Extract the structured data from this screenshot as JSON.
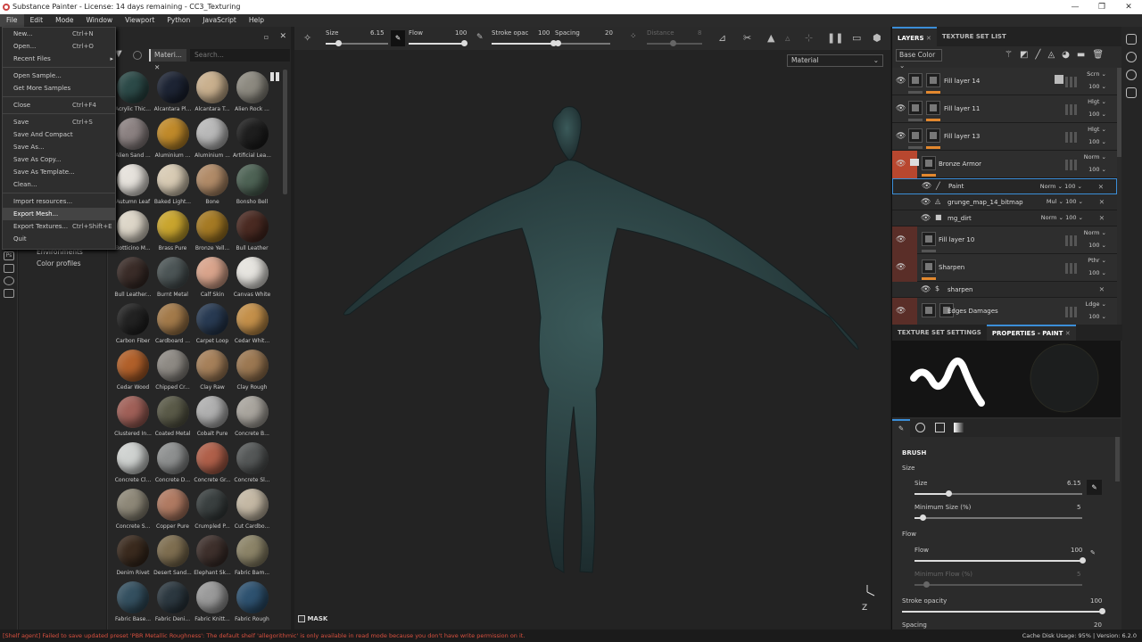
{
  "window": {
    "title": "Substance Painter - License: 14 days remaining - CC3_Texturing",
    "controls": [
      "—",
      "❐",
      "✕"
    ]
  },
  "menubar": [
    "File",
    "Edit",
    "Mode",
    "Window",
    "Viewport",
    "Python",
    "JavaScript",
    "Help"
  ],
  "file_menu": [
    {
      "label": "New...",
      "shortcut": "Ctrl+N"
    },
    {
      "label": "Open...",
      "shortcut": "Ctrl+O"
    },
    {
      "label": "Recent Files",
      "submenu": true
    },
    {
      "sep": true
    },
    {
      "label": "Open Sample..."
    },
    {
      "label": "Get More Samples"
    },
    {
      "sep": true
    },
    {
      "label": "Close",
      "shortcut": "Ctrl+F4"
    },
    {
      "sep": true
    },
    {
      "label": "Save",
      "shortcut": "Ctrl+S"
    },
    {
      "label": "Save And Compact"
    },
    {
      "label": "Save As..."
    },
    {
      "label": "Save As Copy..."
    },
    {
      "label": "Save As Template..."
    },
    {
      "label": "Clean..."
    },
    {
      "sep": true
    },
    {
      "label": "Import resources..."
    },
    {
      "label": "Export Mesh...",
      "highlighted": true
    },
    {
      "label": "Export Textures...",
      "shortcut": "Ctrl+Shift+E"
    },
    {
      "label": "Quit"
    }
  ],
  "shelf": {
    "categories": [
      "Environments",
      "Color profiles"
    ],
    "filter_tag": "Materi...",
    "search_placeholder": "Search...",
    "materials": [
      [
        "Acrylic Thic...",
        "#2c4a48"
      ],
      [
        "Alcantara Pl...",
        "#1d2434"
      ],
      [
        "Alcantara T...",
        "#c9b08e"
      ],
      [
        "Alien Rock ...",
        "#8d8a80"
      ],
      [
        "Alien Sand ...",
        "#8c8282"
      ],
      [
        "Aluminium ...",
        "#c08a2a"
      ],
      [
        "Aluminium ...",
        "#b9b9b9"
      ],
      [
        "Artificial Lea...",
        "#1e1e1e"
      ],
      [
        "Autumn Leaf",
        "#e6e2dc"
      ],
      [
        "Baked Light...",
        "#d8cbb4"
      ],
      [
        "Bone",
        "#b18b68"
      ],
      [
        "Bonsho Bell",
        "#4e6355"
      ],
      [
        "Botticino M...",
        "#ddd6c8"
      ],
      [
        "Brass Pure",
        "#c9a52e"
      ],
      [
        "Bronze Yell...",
        "#a57a24"
      ],
      [
        "Bull Leather",
        "#4a2a22"
      ],
      [
        "Bull Leather...",
        "#3a2c28"
      ],
      [
        "Burnt Metal",
        "#4c5556"
      ],
      [
        "Calf Skin",
        "#d9a48c"
      ],
      [
        "Canvas White",
        "#e6e4df"
      ],
      [
        "Carbon Fiber",
        "#222222"
      ],
      [
        "Cardboard ...",
        "#a37a4a"
      ],
      [
        "Carpet Loop",
        "#283a52"
      ],
      [
        "Cedar Whit...",
        "#c4904a"
      ],
      [
        "Cedar Wood",
        "#b1602a"
      ],
      [
        "Chipped Cr...",
        "#8e8a84"
      ],
      [
        "Clay Raw",
        "#a6805a"
      ],
      [
        "Clay Rough",
        "#9c7852"
      ],
      [
        "Clustered In...",
        "#a06058"
      ],
      [
        "Coated Metal",
        "#5a5a48"
      ],
      [
        "Cobalt Pure",
        "#b0b0b0"
      ],
      [
        "Concrete B...",
        "#a9a59e"
      ],
      [
        "Concrete Cl...",
        "#cfd2d0"
      ],
      [
        "Concrete D...",
        "#8e9090"
      ],
      [
        "Concrete Gr...",
        "#b0604a"
      ],
      [
        "Concrete Sl...",
        "#555858"
      ],
      [
        "Concrete S...",
        "#8e8878"
      ],
      [
        "Copper Pure",
        "#b07a62"
      ],
      [
        "Crumpled P...",
        "#3a4040"
      ],
      [
        "Cut Cardbo...",
        "#c4b8a4"
      ],
      [
        "Denim Rivet",
        "#3a2a1e"
      ],
      [
        "Desert Sand...",
        "#7e6e50"
      ],
      [
        "Elephant Sk...",
        "#3e302c"
      ],
      [
        "Fabric Bam...",
        "#8c8468"
      ],
      [
        "Fabric Base...",
        "#345060"
      ],
      [
        "Fabric Deni...",
        "#2c3840"
      ],
      [
        "Fabric Knitt...",
        "#9a9a9a"
      ],
      [
        "Fabric Rough",
        "#2e5270"
      ]
    ]
  },
  "toolbar": {
    "size_label": "Size",
    "size_value": "6.15",
    "size_fraction": 0.2,
    "flow_label": "Flow",
    "flow_value": "100",
    "flow_fraction": 1.0,
    "stroke_label": "Stroke opac",
    "stroke_value": "100",
    "spacing_label": "Spacing",
    "spacing_value": "20",
    "spacing_fraction": 0.05,
    "distance_label": "Distance",
    "distance_value": "8"
  },
  "viewport": {
    "material_mode": "Material",
    "mask_label": "MASK",
    "axis_label": "Z"
  },
  "layers": {
    "tabs": [
      "LAYERS",
      "TEXTURE SET LIST"
    ],
    "channel": "Base Color",
    "rows": [
      {
        "name": "Fill layer 14",
        "blend": "Scrn",
        "opacity": "100"
      },
      {
        "name": "Fill layer 11",
        "blend": "Hlgt",
        "opacity": "100"
      },
      {
        "name": "Fill layer 13",
        "blend": "Hlgt",
        "opacity": "100"
      },
      {
        "name": "Bronze Armor",
        "blend": "Norm",
        "opacity": "100"
      },
      {
        "name": "Paint",
        "blend": "Norm",
        "opacity": "100"
      },
      {
        "name": "grunge_map_14_bitmap",
        "blend": "Mul",
        "opacity": "100"
      },
      {
        "name": "mg_dirt",
        "blend": "Norm",
        "opacity": "100"
      },
      {
        "name": "Fill layer 10",
        "blend": "Norm",
        "opacity": "100"
      },
      {
        "name": "Sharpen",
        "blend": "Pthr",
        "opacity": "100"
      },
      {
        "name": "sharpen"
      },
      {
        "name": "Edges Damages",
        "blend": "Ldge",
        "opacity": "100"
      }
    ]
  },
  "properties": {
    "tabs": [
      "TEXTURE SET SETTINGS",
      "PROPERTIES - PAINT"
    ],
    "section": "BRUSH",
    "size_group": "Size",
    "size_label": "Size",
    "size_value": "6.15",
    "size_fraction": 0.2,
    "minsize_label": "Minimum Size (%)",
    "minsize_value": "5",
    "minsize_fraction": 0.05,
    "flow_group": "Flow",
    "flow_label": "Flow",
    "flow_value": "100",
    "flow_fraction": 1.0,
    "minflow_label": "Minimum Flow (%)",
    "minflow_value": "5",
    "stroke_label": "Stroke opacity",
    "stroke_value": "100",
    "spacing_label": "Spacing",
    "spacing_value": "20"
  },
  "status": {
    "error": "[Shelf agent] Failed to save updated preset 'PBR Metallic Roughness': The default shelf 'allegorithmic' is only available in read mode because you don't have write permission on it.",
    "cache": "Cache Disk Usage:   95% | Version: 6.2.0"
  },
  "colors": {
    "accent": "#3b8ed8",
    "orange": "#e3882e",
    "group_red": "#b8472f",
    "error": "#d9503f"
  }
}
